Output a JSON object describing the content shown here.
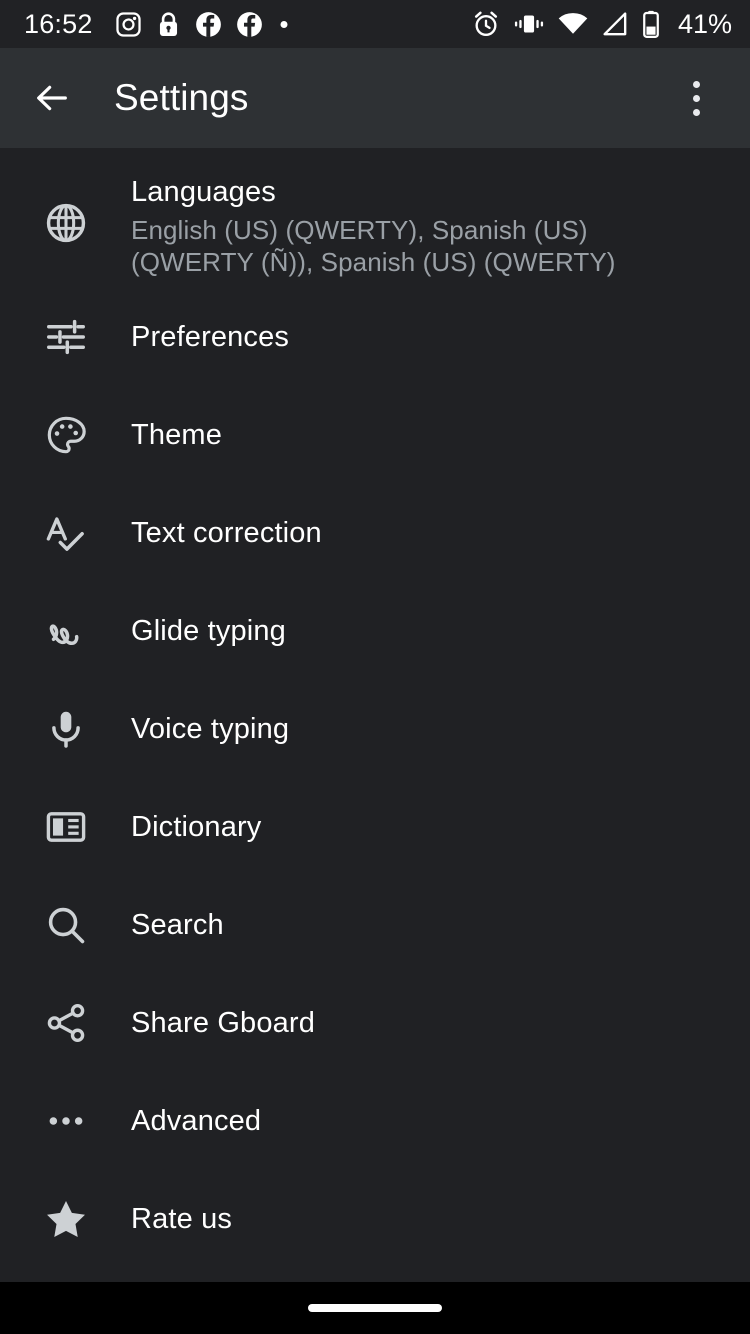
{
  "status_bar": {
    "clock": "16:52",
    "battery_percent": "41%",
    "left_icons": [
      "instagram-icon",
      "lock-icon",
      "facebook-icon",
      "facebook-icon-2",
      "notification-dot-icon"
    ],
    "right_icons": [
      "alarm-icon",
      "vibrate-icon",
      "wifi-icon",
      "cellular-signal-icon",
      "battery-icon"
    ],
    "background_color": "#212225",
    "foreground_color": "#ffffff"
  },
  "app_bar": {
    "title": "Settings",
    "back_icon": "arrow-back-icon",
    "overflow_icon": "more-vert-icon",
    "background_color": "#2e3134"
  },
  "list": {
    "items": [
      {
        "label": "Languages",
        "sublabel": "English (US) (QWERTY), Spanish (US) (QWERTY (Ñ)), Spanish (US) (QWERTY)",
        "icon": "globe-icon"
      },
      {
        "label": "Preferences",
        "icon": "tune-sliders-icon"
      },
      {
        "label": "Theme",
        "icon": "palette-icon"
      },
      {
        "label": "Text correction",
        "icon": "spellcheck-icon"
      },
      {
        "label": "Glide typing",
        "icon": "gesture-icon"
      },
      {
        "label": "Voice typing",
        "icon": "microphone-icon"
      },
      {
        "label": "Dictionary",
        "icon": "book-reader-icon"
      },
      {
        "label": "Search",
        "icon": "search-icon"
      },
      {
        "label": "Share Gboard",
        "icon": "share-icon"
      },
      {
        "label": "Advanced",
        "icon": "more-horiz-icon"
      },
      {
        "label": "Rate us",
        "icon": "star-icon"
      }
    ],
    "background_color": "#202124",
    "title_color": "#ffffff",
    "sublabel_color": "#9aa0a6"
  },
  "nav_bar": {
    "gesture_pill": "home-gesture-pill",
    "background_color": "#000000"
  }
}
